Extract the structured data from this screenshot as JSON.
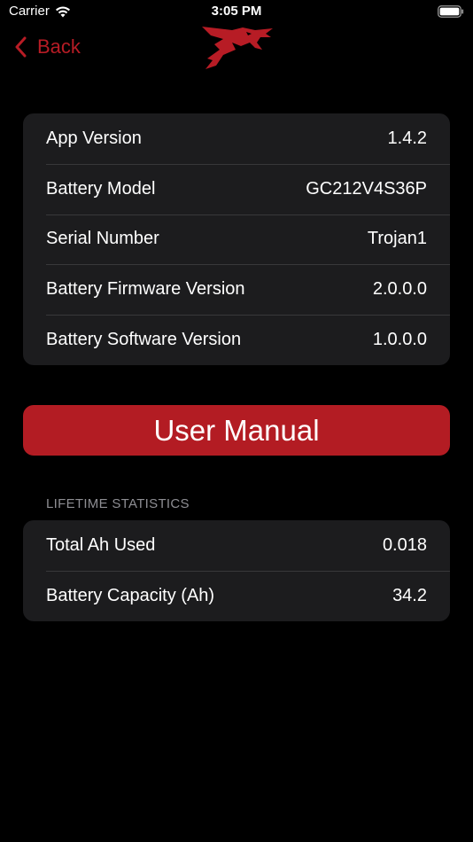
{
  "status_bar": {
    "carrier": "Carrier",
    "time": "3:05 PM"
  },
  "nav": {
    "back_label": "Back",
    "accent_color": "#b71c25"
  },
  "device_info": {
    "rows": [
      {
        "label": "App Version",
        "value": "1.4.2"
      },
      {
        "label": "Battery Model",
        "value": "GC212V4S36P"
      },
      {
        "label": "Serial Number",
        "value": "Trojan1"
      },
      {
        "label": "Battery Firmware Version",
        "value": "2.0.0.0"
      },
      {
        "label": "Battery Software Version",
        "value": "1.0.0.0"
      }
    ]
  },
  "user_manual": {
    "label": "User Manual",
    "color": "#b31c23"
  },
  "lifetime_statistics": {
    "header": "LIFETIME STATISTICS",
    "rows": [
      {
        "label": "Total Ah Used",
        "value": "0.018"
      },
      {
        "label": "Battery Capacity (Ah)",
        "value": "34.2"
      }
    ]
  },
  "icons": [
    "wifi-icon",
    "battery-icon",
    "back-chevron-icon",
    "logo-icon"
  ]
}
